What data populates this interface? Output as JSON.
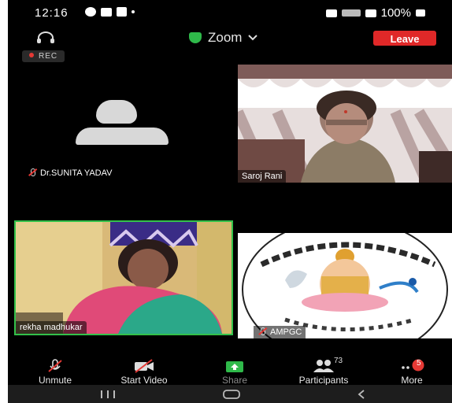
{
  "status_bar": {
    "time": "12:16",
    "battery": "100%"
  },
  "header": {
    "app_title": "Zoom",
    "leave_label": "Leave"
  },
  "recording_badge": "REC",
  "participants_grid": [
    {
      "name": "Dr.SUNITA YADAV",
      "video": false
    },
    {
      "name": "Saroj Rani",
      "video": true
    },
    {
      "name": "rekha madhukar",
      "video": true,
      "active_speaker": true
    },
    {
      "name": "AMPGC",
      "video": true
    }
  ],
  "toolbar": {
    "unmute": "Unmute",
    "start_video": "Start Video",
    "share": "Share",
    "participants": "Participants",
    "participants_count": "73",
    "more": "More",
    "more_badge": "5"
  },
  "colors": {
    "leave": "#e02828",
    "share": "#2fb94a",
    "active_border": "#33c14a",
    "badge": "#e53935"
  },
  "icons": [
    "headphones-icon",
    "shield-icon",
    "chevron-down-icon",
    "mic-off-icon",
    "video-off-icon",
    "share-icon",
    "participants-icon",
    "more-icon"
  ]
}
